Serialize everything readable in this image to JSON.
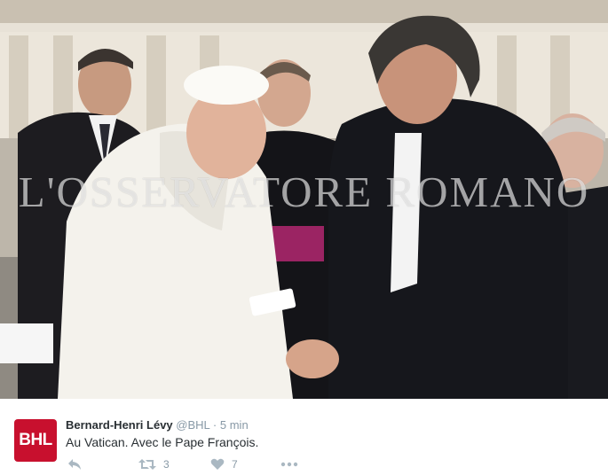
{
  "image": {
    "watermark": "L'OSSERVATORE ROMANO"
  },
  "tweet": {
    "avatar_text": "BHL",
    "author_name": "Bernard-Henri Lévy",
    "handle": "@BHL",
    "separator": "·",
    "timestamp": "5 min",
    "text": "Au Vatican. Avec le Pape François.",
    "retweet_count": "3",
    "like_count": "7"
  },
  "colors": {
    "avatar_bg": "#c8102e",
    "name": "#292f33",
    "meta": "#8899a6"
  },
  "icons": {
    "reply": "reply-icon",
    "retweet": "retweet-icon",
    "like": "heart-icon",
    "more": "more-icon"
  }
}
